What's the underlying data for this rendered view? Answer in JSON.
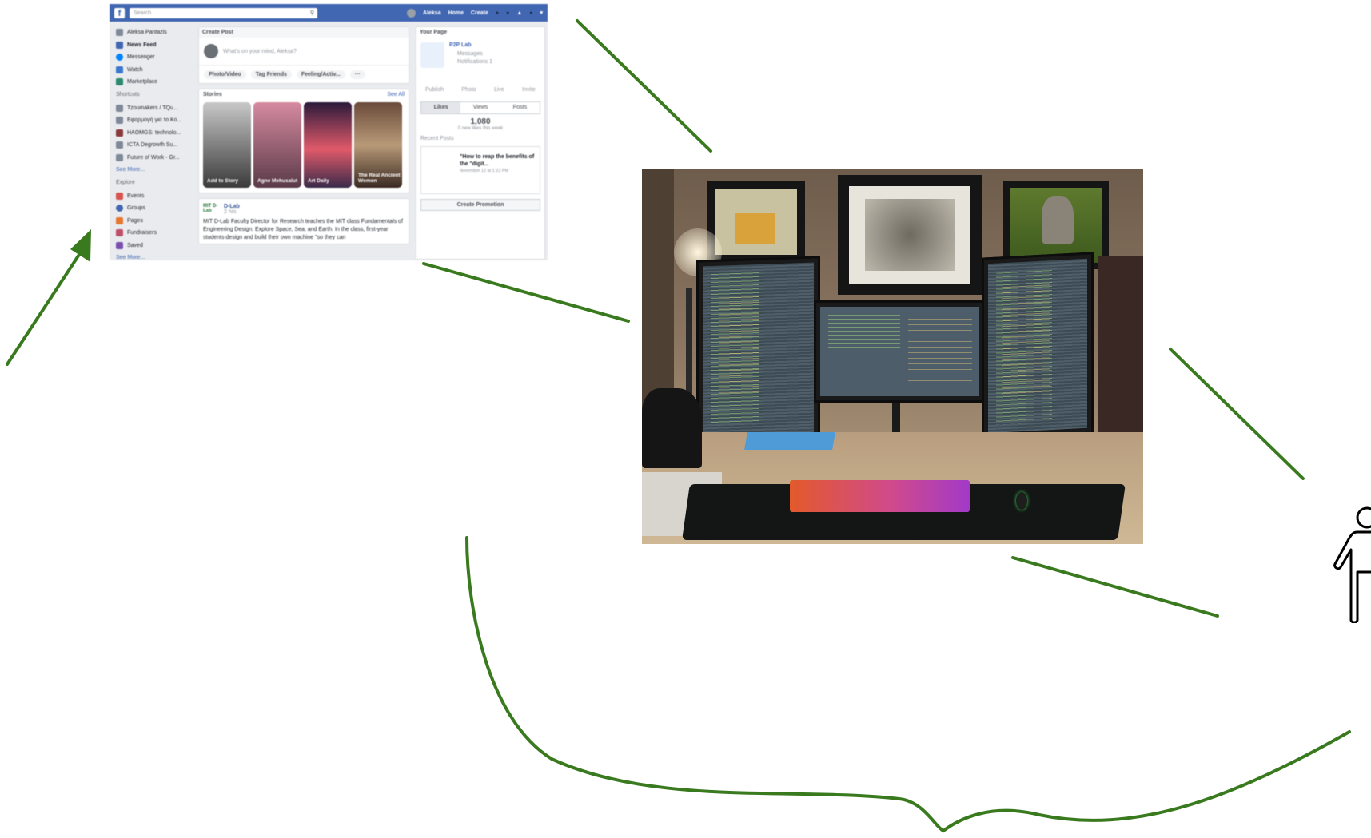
{
  "facebook_screenshot": {
    "topbar": {
      "logo": "f",
      "search_placeholder": "Search",
      "profile_name": "Aleksa",
      "nav_home": "Home",
      "nav_create": "Create"
    },
    "left_menu": {
      "profile": "Aleksa Pantazis",
      "main_items": [
        "News Feed",
        "Messenger",
        "Watch",
        "Marketplace"
      ],
      "shortcuts_heading": "Shortcuts",
      "shortcuts": [
        "Tzoumakers / TQu...",
        "Εφαρμογή για το Κο...",
        "HAOMGS: technolo...",
        "ICTA Degrowth Su...",
        "Future of Work - Gr..."
      ],
      "see_more": "See More...",
      "explore_heading": "Explore",
      "explore": [
        "Events",
        "Groups",
        "Pages",
        "Fundraisers",
        "Saved"
      ],
      "see_more_2": "See More..."
    },
    "create_post": {
      "heading": "Create Post",
      "placeholder": "What's on your mind, Aleksa?",
      "actions": [
        "Photo/Video",
        "Tag Friends",
        "Feeling/Activ...",
        "···"
      ]
    },
    "stories": {
      "heading": "Stories",
      "see_all": "See All",
      "items": [
        "Add to Story",
        "Agne Mehusalut",
        "Art Daily",
        "The Real Ancient Women"
      ]
    },
    "post": {
      "org_logo": "MIT D-Lab",
      "author": "D-Lab",
      "time": "2 hrs",
      "text": "MIT D-Lab Faculty Director for Research teaches the MIT class Fundamentals of Engineering Design: Explore Space, Sea, and Earth. In the class, first-year students design and build their own machine \"so they can"
    },
    "your_page": {
      "heading": "Your Page",
      "page_name": "P2P Lab",
      "messages": "Messages",
      "notifications": "Notifications",
      "notif_count": "1",
      "tabs": [
        "Publish",
        "Photo",
        "Live",
        "Invite"
      ],
      "stat_tabs": [
        "Likes",
        "Views",
        "Posts"
      ],
      "likes": "1,080",
      "likes_sub": "0 new likes this week",
      "recent_posts": "Recent Posts",
      "recent_post_title": "\"How to reap the benefits of the \"digit...",
      "recent_post_date": "November 12 at 1:23 PM",
      "create_promotion": "Create Promotion"
    }
  },
  "colors": {
    "arrow_green": "#3a7a1e",
    "facebook_blue": "#4267b2"
  },
  "icons": [
    "arrow-head",
    "person-icon"
  ]
}
